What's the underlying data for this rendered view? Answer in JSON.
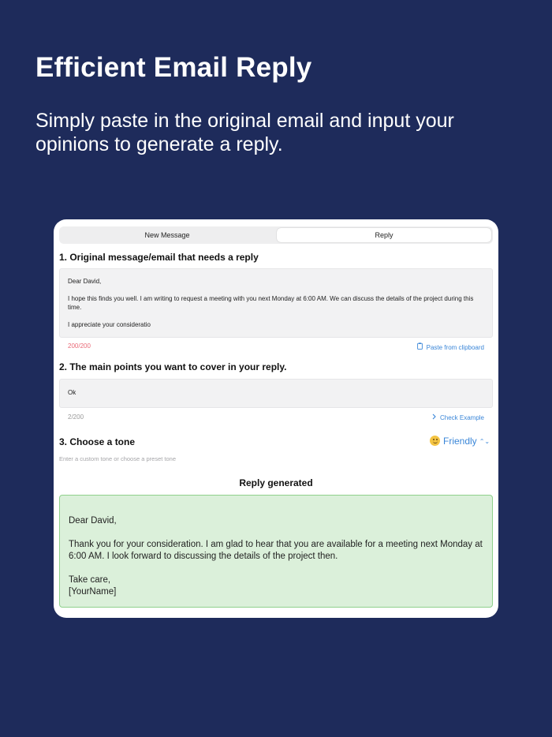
{
  "headline": "Efficient Email Reply",
  "subheadline": "Simply paste in the original email and input your opinions to generate a reply.",
  "tabs": [
    {
      "label": "New Message",
      "selected": false
    },
    {
      "label": "Reply",
      "selected": true
    }
  ],
  "section1": {
    "title": "1. Original message/email that needs a reply",
    "email_lines": [
      "Dear David,",
      "I hope this finds you well. I am writing to request a meeting with you next Monday at 6:00 AM. We can discuss the details of the project during this time.",
      "I appreciate your consideratio"
    ],
    "char_count": "200/200",
    "paste_label": "Paste from clipboard",
    "paste_icon": "clipboard-icon"
  },
  "section2": {
    "title": "2. The main points you want to cover in your reply.",
    "value": "Ok",
    "char_count": "2/200",
    "example_label": "Check Example",
    "example_icon": "chevron-right-icon"
  },
  "section3": {
    "title": "3. Choose a tone",
    "placeholder": "Enter a custom tone or choose a preset tone",
    "tone_value": "Friendly",
    "tone_icon": "smiling-face-icon"
  },
  "reply": {
    "title": "Reply generated",
    "paragraphs": [
      "Dear David,",
      "Thank you for your consideration. I am glad to hear that you are available for a meeting next Monday at 6:00 AM. I look forward to discussing the details of the project then.",
      "Take care,"
    ],
    "signature": "[YourName]"
  },
  "colors": {
    "background": "#1e2b5b",
    "accent": "#3a86d8",
    "count_full": "#e96a78",
    "reply_bg": "#dbf0da",
    "reply_border": "#8fd08c"
  }
}
